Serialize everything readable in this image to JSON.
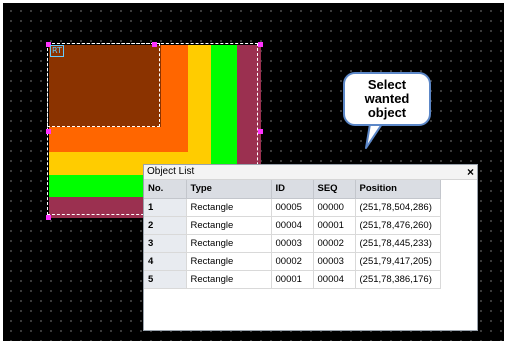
{
  "canvas": {
    "tag_label": "RT",
    "colors": {
      "background": "#000000",
      "rect1": "#9b3050",
      "rect2": "#00ff00",
      "rect3": "#ffcc00",
      "rect4": "#ff6600",
      "rect5": "#8b3300",
      "selection_handle": "#ff33ff"
    }
  },
  "callout": {
    "text": "Select\nwanted\nobject"
  },
  "object_list": {
    "title": "Object List",
    "close_label": "×",
    "columns": [
      "No.",
      "Type",
      "ID",
      "SEQ",
      "Position"
    ],
    "rows": [
      {
        "no": "1",
        "type": "Rectangle",
        "id": "00005",
        "seq": "00000",
        "position": "(251,78,504,286)"
      },
      {
        "no": "2",
        "type": "Rectangle",
        "id": "00004",
        "seq": "00001",
        "position": "(251,78,476,260)"
      },
      {
        "no": "3",
        "type": "Rectangle",
        "id": "00003",
        "seq": "00002",
        "position": "(251,78,445,233)"
      },
      {
        "no": "4",
        "type": "Rectangle",
        "id": "00002",
        "seq": "00003",
        "position": "(251,79,417,205)"
      },
      {
        "no": "5",
        "type": "Rectangle",
        "id": "00001",
        "seq": "00004",
        "position": "(251,78,386,176)"
      }
    ]
  }
}
